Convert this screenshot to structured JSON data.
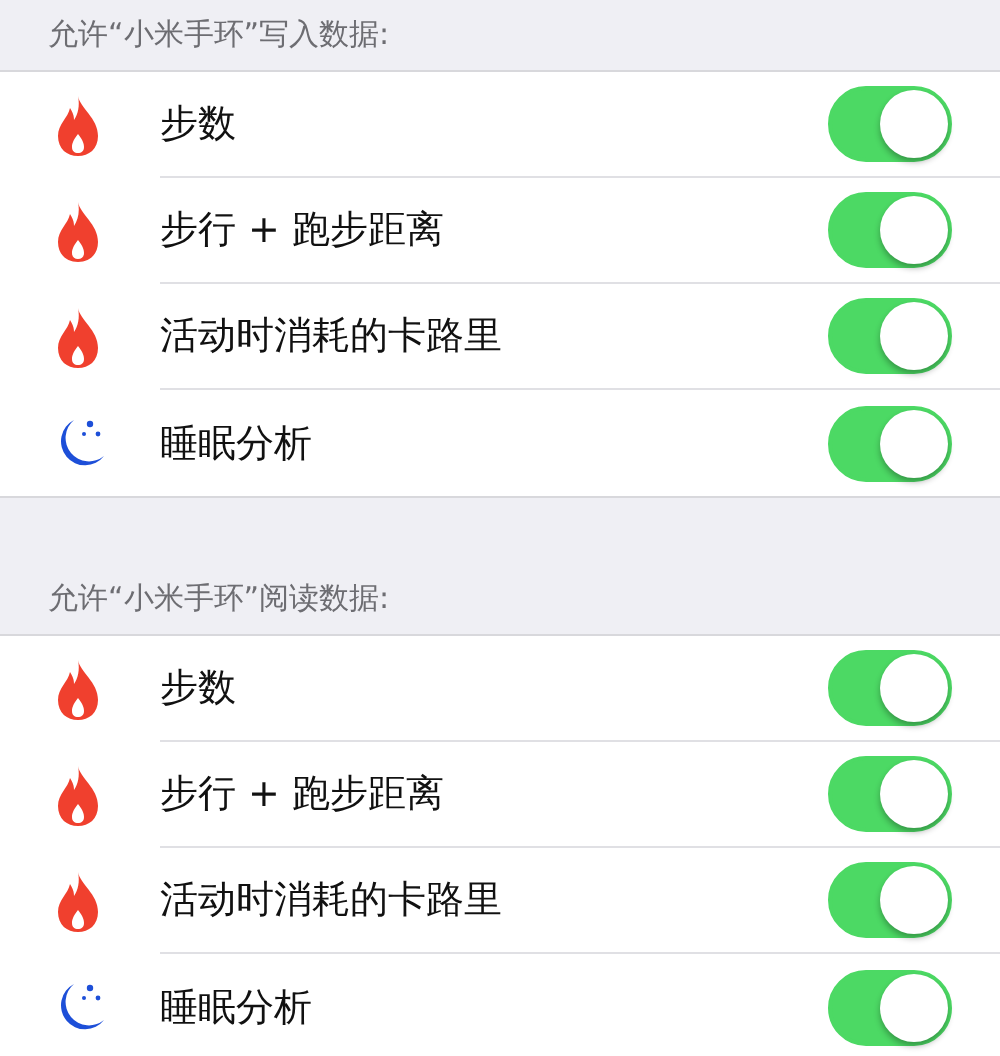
{
  "sections": [
    {
      "header": "允许“小米手环”写入数据:",
      "items": [
        {
          "kind": "flame",
          "label": "步数",
          "on": true
        },
        {
          "kind": "flame",
          "label": "步行 + 跑步距离",
          "on": true
        },
        {
          "kind": "flame",
          "label": "活动时消耗的卡路里",
          "on": true
        },
        {
          "kind": "moon",
          "label": "睡眠分析",
          "on": true
        }
      ]
    },
    {
      "header": "允许“小米手环”阅读数据:",
      "items": [
        {
          "kind": "flame",
          "label": "步数",
          "on": true
        },
        {
          "kind": "flame",
          "label": "步行 + 跑步距离",
          "on": true
        },
        {
          "kind": "flame",
          "label": "活动时消耗的卡路里",
          "on": true
        },
        {
          "kind": "moon",
          "label": "睡眠分析",
          "on": true
        }
      ]
    }
  ]
}
